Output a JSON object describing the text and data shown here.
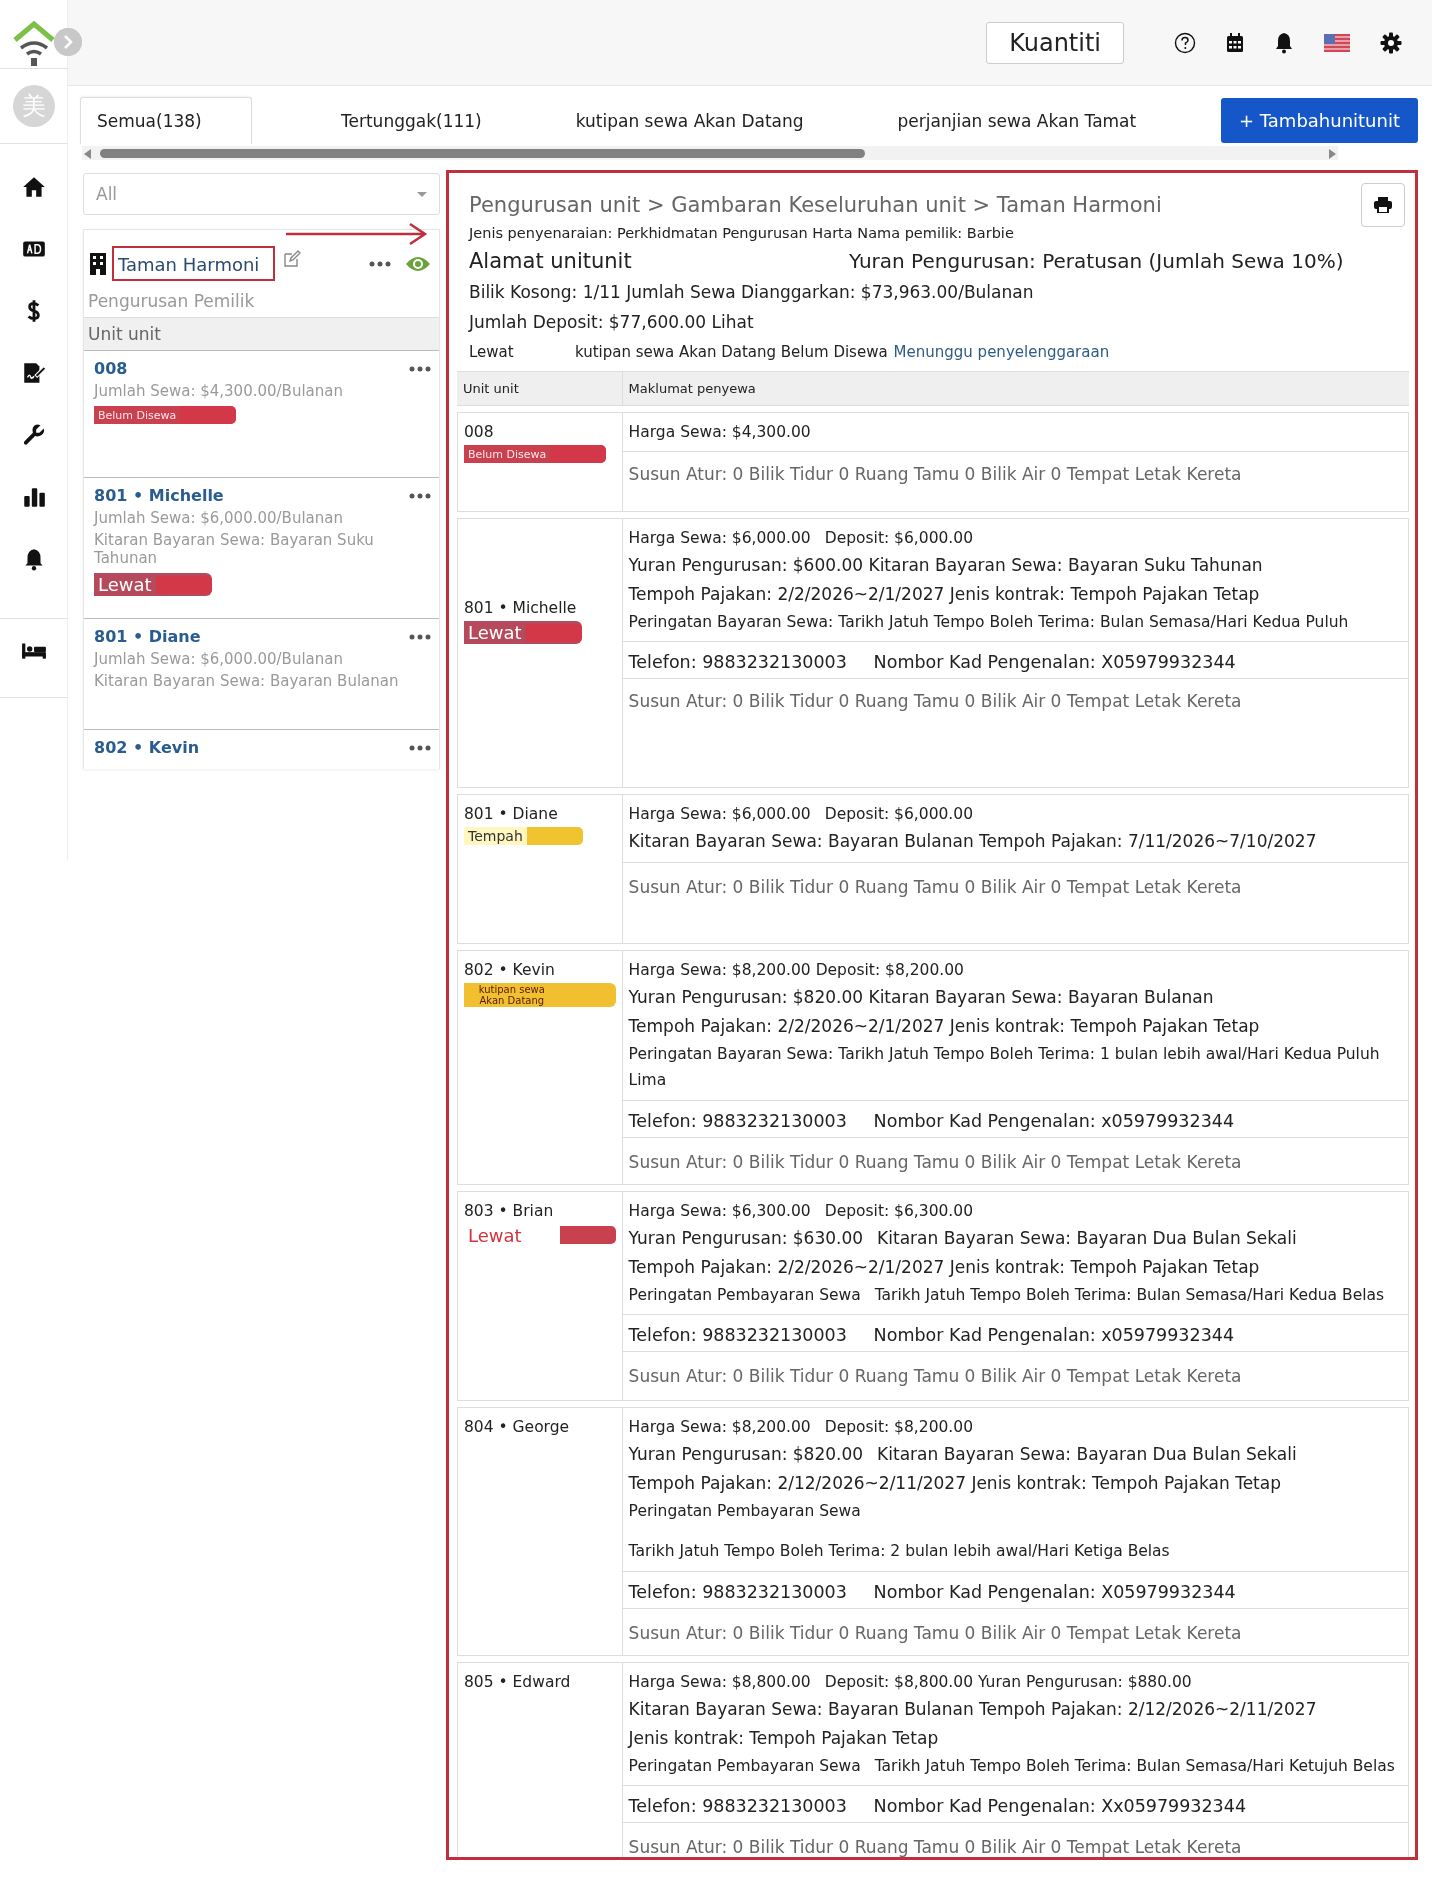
{
  "topbar": {
    "quantity_button": "Kuantiti"
  },
  "rail": {
    "avatar": "美"
  },
  "tabs": [
    {
      "label": "Semua(138)",
      "selected": true
    },
    {
      "label": "Tertunggak(111)",
      "selected": false
    },
    {
      "label": "kutipan sewa Akan Datang",
      "selected": false
    },
    {
      "label": "perjanjian sewa Akan Tamat",
      "selected": false
    }
  ],
  "add_button": "+ Tambahunitunit",
  "filter": {
    "value": "All"
  },
  "property": {
    "name": "Taman Harmoni",
    "subtitle": "Pengurusan Pemilik",
    "section": "Unit unit"
  },
  "unit_list": [
    {
      "title": "008",
      "lines": [
        "Jumlah Sewa: $4,300.00/Bulanan"
      ],
      "badge": {
        "label": "Belum Disewa",
        "kind": "vacant"
      }
    },
    {
      "title": "801 • Michelle",
      "lines": [
        "Jumlah Sewa: $6,000.00/Bulanan",
        "Kitaran Bayaran Sewa: Bayaran Suku Tahunan"
      ],
      "badge": {
        "label": "Lewat",
        "kind": "overdue"
      }
    },
    {
      "title": "801 • Diane",
      "lines": [
        "Jumlah Sewa: $6,000.00/Bulanan",
        "Kitaran Bayaran Sewa: Bayaran Bulanan"
      ]
    },
    {
      "title": "802 • Kevin"
    }
  ],
  "detail": {
    "breadcrumb": "Pengurusan unit > Gambaran Keseluruhan unit > Taman Harmoni",
    "listing": "Jenis penyenaraian: Perkhidmatan Pengurusan Harta Nama pemilik: Barbie",
    "address": "Alamat unitunit",
    "fee": "Yuran Pengurusan: Peratusan (Jumlah Sewa 10%)",
    "vacancy": "Bilik Kosong: 1/11 Jumlah Sewa Dianggarkan: $73,963.00/Bulanan",
    "deposit": "Jumlah Deposit: $77,600.00 Lihat",
    "legend": [
      {
        "label": "Lewat",
        "kind": "text"
      },
      {
        "label": "kutipan sewa Akan Datang Belum Disewa",
        "kind": "text"
      },
      {
        "label": "Menunggu penyelenggaraan",
        "kind": "link"
      }
    ],
    "columns": [
      "Unit unit",
      "Maklumat penyewa"
    ],
    "rows": [
      {
        "title": "008",
        "badge": {
          "label": "Belum Disewa",
          "kind": "vacant"
        },
        "sections": [
          {
            "kind": "terms",
            "lines": [
              [
                "Harga Sewa: $4,300.00"
              ]
            ]
          },
          {
            "kind": "layout",
            "text": "Susun Atur: 0 Bilik Tidur 0 Ruang Tamu 0 Bilik Air 0 Tempat Letak Kereta"
          }
        ]
      },
      {
        "title": "801 • Michelle",
        "badge": {
          "label": "Lewat",
          "kind": "overdue"
        },
        "sections": [
          {
            "kind": "terms",
            "lines": [
              [
                "Harga Sewa: $6,000.00",
                "Deposit: $6,000.00"
              ],
              [
                "Yuran Pengurusan: $600.00 Kitaran Bayaran Sewa: Bayaran Suku Tahunan"
              ],
              [
                "Tempoh Pajakan: 2/2/2026~2/1/2027 Jenis kontrak: Tempoh Pajakan Tetap"
              ],
              [
                "Peringatan Bayaran Sewa: Tarikh Jatuh Tempo Boleh Terima: Bulan Semasa/Hari Kedua Puluh"
              ]
            ]
          },
          {
            "kind": "contact",
            "parts": [
              "Telefon: 9883232130003",
              "Nombor Kad Pengenalan: X05979932344"
            ]
          },
          {
            "kind": "layout",
            "text": "Susun Atur: 0 Bilik Tidur 0 Ruang Tamu 0 Bilik Air 0 Tempat Letak Kereta"
          }
        ]
      },
      {
        "title": "801 • Diane",
        "badge": {
          "label": "Tempah",
          "kind": "booked"
        },
        "sections": [
          {
            "kind": "terms",
            "lines": [
              [
                "Harga Sewa: $6,000.00",
                "Deposit: $6,000.00"
              ],
              [
                "Kitaran Bayaran Sewa: Bayaran Bulanan Tempoh Pajakan: 7/11/2026~7/10/2027"
              ]
            ]
          },
          {
            "kind": "layout",
            "text": "Susun Atur: 0 Bilik Tidur 0 Ruang Tamu 0 Bilik Air 0 Tempat Letak Kereta"
          }
        ]
      },
      {
        "title": "802 • Kevin",
        "badge": {
          "label": "kutipan sewa Akan Datang",
          "kind": "upcoming"
        },
        "sections": [
          {
            "kind": "terms",
            "lines": [
              [
                "Harga Sewa: $8,200.00 Deposit: $8,200.00"
              ],
              [
                "Yuran Pengurusan: $820.00 Kitaran Bayaran Sewa: Bayaran Bulanan"
              ],
              [
                "Tempoh Pajakan: 2/2/2026~2/1/2027 Jenis kontrak: Tempoh Pajakan Tetap"
              ],
              [
                "Peringatan Bayaran Sewa: Tarikh Jatuh Tempo Boleh Terima: 1 bulan lebih awal/Hari Kedua Puluh Lima"
              ]
            ]
          },
          {
            "kind": "contact",
            "parts": [
              "Telefon: 9883232130003",
              "Nombor Kad Pengenalan: x05979932344"
            ]
          },
          {
            "kind": "layout",
            "text": "Susun Atur: 0 Bilik Tidur 0 Ruang Tamu 0 Bilik Air 0 Tempat Letak Kereta"
          }
        ]
      },
      {
        "title": "803 • Brian",
        "badge": {
          "label": "Lewat",
          "kind": "overdue-text"
        },
        "sections": [
          {
            "kind": "terms",
            "lines": [
              [
                "Harga Sewa: $6,300.00",
                "Deposit: $6,300.00"
              ],
              [
                "Yuran Pengurusan: $630.00",
                "Kitaran Bayaran Sewa: Bayaran Dua Bulan Sekali"
              ],
              [
                "Tempoh Pajakan: 2/2/2026~2/1/2027 Jenis kontrak: Tempoh Pajakan Tetap"
              ],
              [
                "Peringatan Pembayaran Sewa",
                "Tarikh Jatuh Tempo Boleh Terima: Bulan Semasa/Hari Kedua Belas"
              ]
            ]
          },
          {
            "kind": "contact",
            "parts": [
              "Telefon: 9883232130003",
              "Nombor Kad Pengenalan: x05979932344"
            ]
          },
          {
            "kind": "layout",
            "text": "Susun Atur: 0 Bilik Tidur 0 Ruang Tamu 0 Bilik Air 0 Tempat Letak Kereta"
          }
        ]
      },
      {
        "title": "804 • George",
        "sections": [
          {
            "kind": "terms",
            "lines": [
              [
                "Harga Sewa: $8,200.00",
                "Deposit: $8,200.00"
              ],
              [
                "Yuran Pengurusan: $820.00",
                "Kitaran Bayaran Sewa: Bayaran Dua Bulan Sekali"
              ],
              [
                "Tempoh Pajakan: 2/12/2026~2/11/2027 Jenis kontrak: Tempoh Pajakan Tetap"
              ],
              [
                "Peringatan Pembayaran Sewa",
                "Tarikh Jatuh Tempo Boleh Terima: 2 bulan lebih awal/Hari Ketiga Belas"
              ]
            ]
          },
          {
            "kind": "contact",
            "parts": [
              "Telefon: 9883232130003",
              "Nombor Kad Pengenalan: X05979932344"
            ]
          },
          {
            "kind": "layout",
            "text": "Susun Atur: 0 Bilik Tidur 0 Ruang Tamu 0 Bilik Air 0 Tempat Letak Kereta"
          }
        ]
      },
      {
        "title": "805 • Edward",
        "sections": [
          {
            "kind": "terms",
            "lines": [
              [
                "Harga Sewa: $8,800.00",
                "Deposit: $8,800.00 Yuran Pengurusan: $880.00"
              ],
              [
                "Kitaran Bayaran Sewa: Bayaran Bulanan Tempoh Pajakan: 2/12/2026~2/11/2027"
              ],
              [
                "Jenis kontrak: Tempoh Pajakan Tetap"
              ],
              [
                "Peringatan Pembayaran Sewa",
                "Tarikh Jatuh Tempo Boleh Terima: Bulan Semasa/Hari Ketujuh Belas"
              ]
            ]
          },
          {
            "kind": "contact",
            "parts": [
              "Telefon: 9883232130003",
              "Nombor Kad Pengenalan: Xx05979932344"
            ]
          },
          {
            "kind": "layout",
            "text": "Susun Atur: 0 Bilik Tidur 0 Ruang Tamu 0 Bilik Air 0 Tempat Letak Kereta"
          }
        ]
      }
    ]
  }
}
